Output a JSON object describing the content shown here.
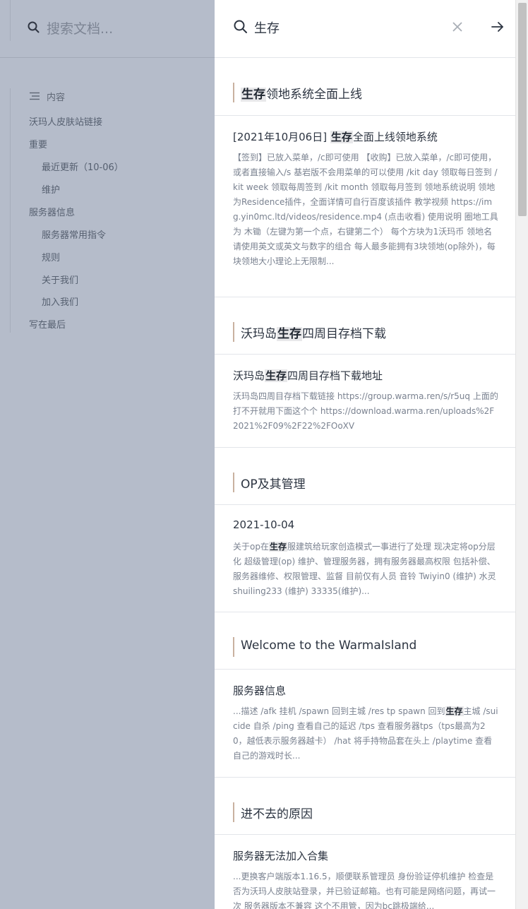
{
  "sidebar": {
    "search_placeholder": "搜索文档...",
    "toc_title": "内容",
    "items": [
      {
        "label": "沃玛人皮肤站链接"
      },
      {
        "label": "重要"
      },
      {
        "label": "最近更新（10-06）"
      },
      {
        "label": "维护"
      },
      {
        "label": "服务器信息"
      },
      {
        "label": "服务器常用指令"
      },
      {
        "label": "规则"
      },
      {
        "label": "关于我们"
      },
      {
        "label": "加入我们"
      },
      {
        "label": "写在最后"
      }
    ]
  },
  "search": {
    "query": "生存"
  },
  "groups": [
    {
      "title_pre": "",
      "title_hl": "生存",
      "title_post": "领地系统全面上线",
      "result": {
        "title_pre": "[2021年10月06日] ",
        "title_hl": "生存",
        "title_post": "全面上线领地系统",
        "snippet_pre": "【签到】已放入菜单，/c即可使用 【收购】已放入菜单，/c即可使用，或者直接输入/s 基岩版不会用菜单的可以使用 /kit day 领取每日签到 /kit week 领取每周签到 /kit month 领取每月签到 领地系统说明 领地为Residence插件，全面详情可自行百度该插件 教学视频 https://img.yin0mc.ltd/videos/residence.mp4 (点击收看) 使用说明 圈地工具为 木锄（左键为第一个点，右键第二个） 每个方块为1沃玛币 领地名请使用英文或英文与数字的组合 每人最多能拥有3块领地(op除外)，每块领地大小理论上无限制...",
        "snippet_hl": "",
        "snippet_post": ""
      }
    },
    {
      "title_pre": "沃玛岛",
      "title_hl": "生存",
      "title_post": "四周目存档下载",
      "result": {
        "title_pre": "沃玛岛",
        "title_hl": "生存",
        "title_post": "四周目存档下载地址",
        "snippet_pre": "沃玛岛四周目存档下载链接 https://group.warma.ren/s/r5uq 上面的打不开就用下面这个个 https://download.warma.ren/uploads%2F2021%2F09%2F22%2FOoXV",
        "snippet_hl": "",
        "snippet_post": ""
      }
    },
    {
      "title_pre": "OP及其管理",
      "title_hl": "",
      "title_post": "",
      "result": {
        "title_pre": "2021-10-04",
        "title_hl": "",
        "title_post": "",
        "snippet_pre": "关于op在",
        "snippet_hl": "生存",
        "snippet_post": "服建筑给玩家创造模式一事进行了处理 现决定将op分层化 超级管理(op) 维护、管理服务器，拥有服务器最高权限 包括补偿、服务器维修、权限管理、监督 目前仅有人员 音铃 Twiyin0 (维护) 水灵shuiling233 (维护) 33335(维护)..."
      }
    },
    {
      "title_pre": "Welcome to the WarmaIsland",
      "title_hl": "",
      "title_post": "",
      "result": {
        "title_pre": "服务器信息",
        "title_hl": "",
        "title_post": "",
        "snippet_pre": "...描述 /afk 挂机 /spawn 回到主城 /res tp spawn 回到",
        "snippet_hl": "生存",
        "snippet_post": "主城 /suicide 自杀 /ping 查看自己的延迟 /tps 查看服务器tps（tps最高为20，越低表示服务器越卡） /hat 将手持物品套在头上 /playtime 查看自己的游戏时长..."
      }
    },
    {
      "title_pre": "进不去的原因",
      "title_hl": "",
      "title_post": "",
      "result": {
        "title_pre": "服务器无法加入合集",
        "title_hl": "",
        "title_post": "",
        "snippet_pre": "...更换客户端版本1.16.5，顺便联系管理员 身份验证停机维护 检查是否为沃玛人皮肤站登录，并已验证邮箱。也有可能是网络问题，再试一次 服务器版本不兼容 这个不用管，因为bc跳极端给...",
        "snippet_hl": "",
        "snippet_post": ""
      }
    }
  ]
}
